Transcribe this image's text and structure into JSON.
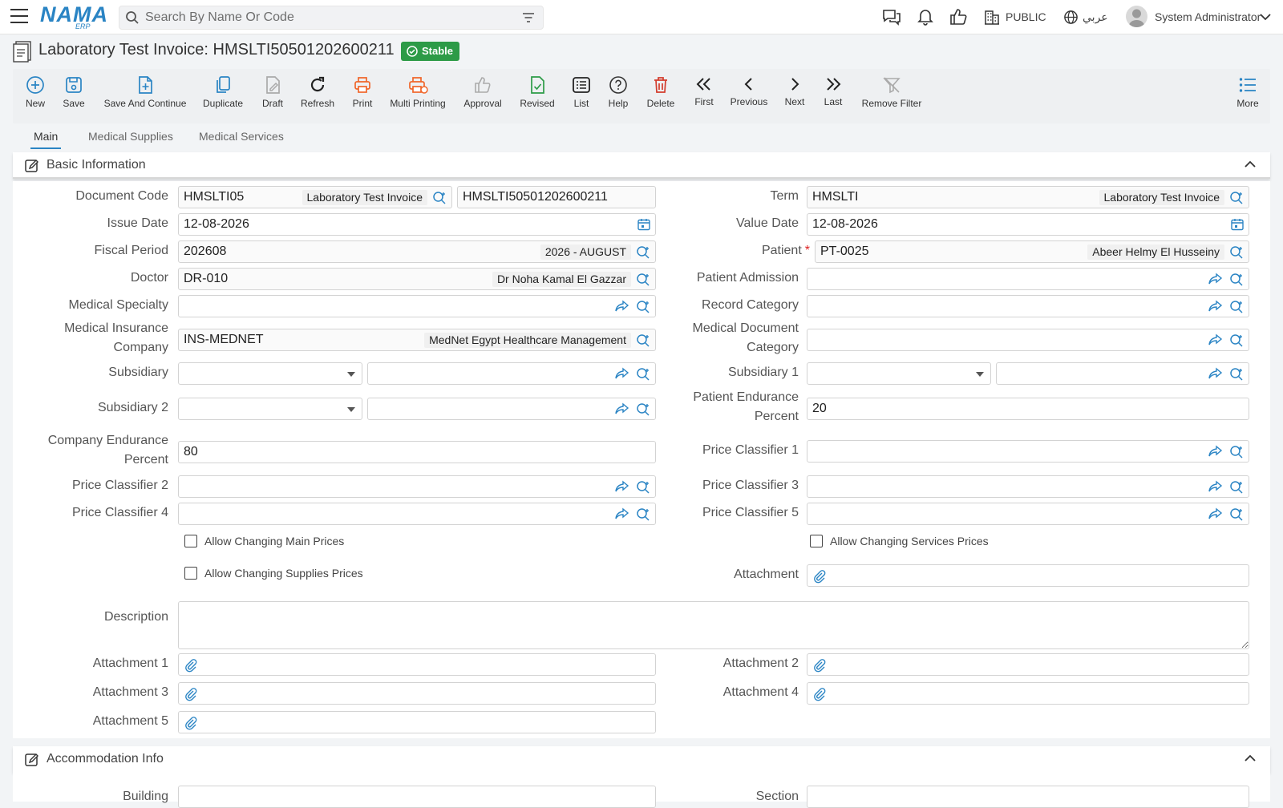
{
  "topbar": {
    "search_placeholder": "Search By Name Or Code",
    "branch": "PUBLIC",
    "language": "عربي",
    "user": "System Administrator"
  },
  "logo": {
    "text": "NAMA",
    "sub": "ERP"
  },
  "page": {
    "title": "Laboratory Test Invoice: HMSLTI50501202600211",
    "status": "Stable"
  },
  "toolbar": {
    "new": "New",
    "save": "Save",
    "save_continue": "Save And Continue",
    "duplicate": "Duplicate",
    "draft": "Draft",
    "refresh": "Refresh",
    "print": "Print",
    "multi_printing": "Multi Printing",
    "approval": "Approval",
    "revised": "Revised",
    "list": "List",
    "help": "Help",
    "delete": "Delete",
    "first": "First",
    "previous": "Previous",
    "next": "Next",
    "last": "Last",
    "remove_filter": "Remove Filter",
    "more": "More"
  },
  "tabs": {
    "main": "Main",
    "supplies": "Medical Supplies",
    "services": "Medical Services"
  },
  "sections": {
    "basic": "Basic Information",
    "accommodation": "Accommodation Info"
  },
  "form": {
    "document_code": {
      "label": "Document Code",
      "code": "HMSLTI05",
      "name": "Laboratory Test Invoice",
      "number": "HMSLTI50501202600211"
    },
    "term": {
      "label": "Term",
      "code": "HMSLTI",
      "name": "Laboratory Test Invoice"
    },
    "issue_date": {
      "label": "Issue Date",
      "value": "12-08-2026"
    },
    "value_date": {
      "label": "Value Date",
      "value": "12-08-2026"
    },
    "fiscal_period": {
      "label": "Fiscal Period",
      "code": "202608",
      "name": "2026 - AUGUST"
    },
    "patient": {
      "label": "Patient",
      "required": "*",
      "code": "PT-0025",
      "name": "Abeer Helmy El Husseiny"
    },
    "doctor": {
      "label": "Doctor",
      "code": "DR-010",
      "name": "Dr Noha Kamal El Gazzar"
    },
    "patient_admission": {
      "label": "Patient Admission"
    },
    "medical_specialty": {
      "label": "Medical Specialty"
    },
    "record_category": {
      "label": "Record Category"
    },
    "insurance": {
      "label1": "Medical Insurance",
      "label2": "Company",
      "code": "INS-MEDNET",
      "name": "MedNet Egypt Healthcare Management"
    },
    "doc_category": {
      "label1": "Medical Document",
      "label2": "Category"
    },
    "subsidiary": {
      "label": "Subsidiary"
    },
    "subsidiary1": {
      "label": "Subsidiary 1"
    },
    "subsidiary2": {
      "label": "Subsidiary 2"
    },
    "patient_endurance": {
      "label1": "Patient Endurance",
      "label2": "Percent",
      "value": "20"
    },
    "company_endurance": {
      "label1": "Company Endurance",
      "label2": "Percent",
      "value": "80"
    },
    "price_classifier1": {
      "label": "Price Classifier 1"
    },
    "price_classifier2": {
      "label": "Price Classifier 2"
    },
    "price_classifier3": {
      "label": "Price Classifier 3"
    },
    "price_classifier4": {
      "label": "Price Classifier 4"
    },
    "price_classifier5": {
      "label": "Price Classifier 5"
    },
    "allow_main_prices": "Allow Changing Main Prices",
    "allow_services_prices": "Allow Changing Services Prices",
    "allow_supplies_prices": "Allow Changing Supplies Prices",
    "attachment": {
      "label": "Attachment"
    },
    "description": {
      "label": "Description"
    },
    "attachment1": {
      "label": "Attachment 1"
    },
    "attachment2": {
      "label": "Attachment 2"
    },
    "attachment3": {
      "label": "Attachment 3"
    },
    "attachment4": {
      "label": "Attachment 4"
    },
    "attachment5": {
      "label": "Attachment 5"
    },
    "building": {
      "label": "Building"
    },
    "section": {
      "label": "Section"
    }
  },
  "colors": {
    "accent": "#2a84c4",
    "success": "#2d9b47",
    "danger": "#d33b2c",
    "print": "#f0662a"
  }
}
